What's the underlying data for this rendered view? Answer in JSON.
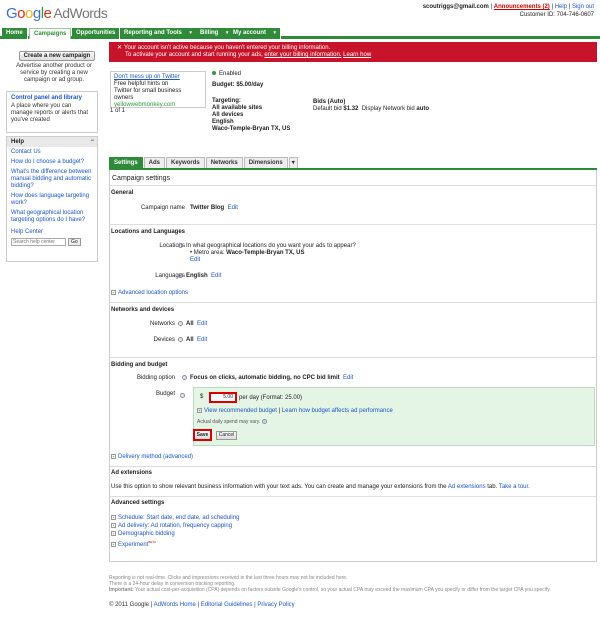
{
  "header": {
    "logo_google": [
      "G",
      "o",
      "o",
      "g",
      "l",
      "e"
    ],
    "logo_product": "AdWords",
    "email": "scoutriggs@gmail.com",
    "announcements": "Announcements (2)",
    "help": "Help",
    "signout": "Sign out",
    "customer_id": "Customer ID: 704-746-0607"
  },
  "nav": {
    "tabs": [
      "Home",
      "Campaigns",
      "Opportunities",
      "Reporting and Tools",
      "Billing",
      "My account"
    ]
  },
  "sidebar": {
    "new_campaign": "Create a new campaign",
    "new_campaign_text": "Advertise another product or service by creating a new campaign or ad group.",
    "control_panel_title": "Control panel and library",
    "control_panel_text": "A place where you can manage reports or alerts that you've created",
    "help_title": "Help",
    "help_minimize": "−",
    "help_links": [
      "Contact Us",
      "How do I choose a budget?",
      "What's the difference between manual bidding and automatic bidding?",
      "How does language targeting work?",
      "What geographical location targeting options do I have?"
    ],
    "help_center": "Help Center",
    "search_placeholder": "Search help center",
    "go": "Go"
  },
  "alert": {
    "close": "✕",
    "line1": "Your account isn't active because you haven't entered your billing information.",
    "line2": "To activate your account and start running your ads,",
    "link1": "enter your billing information.",
    "link2": "Learn how"
  },
  "ad": {
    "title": "Don't mess up on Twitter",
    "line1": "Free helpful hints on",
    "line2": "Twitter for small business owners",
    "url": "yellowwebmonkey.com",
    "pager": "1 of 1"
  },
  "summary": {
    "status": "Enabled",
    "budget": "Budget: $5.00/day",
    "targeting_label": "Targeting:",
    "targeting": [
      "All available sites",
      "All devices",
      "English",
      "Waco-Temple-Bryan TX, US"
    ],
    "bids_label": "Bids (Auto)",
    "bids_line_pre": "Default bid",
    "bids_value": "$1.32",
    "display_bid_pre": "Display Network bid",
    "display_bid_value": "auto"
  },
  "subtabs": [
    "Settings",
    "Ads",
    "Keywords",
    "Networks",
    "Dimensions"
  ],
  "settings": {
    "panel_title": "Campaign settings",
    "general": "General",
    "campaign_name_label": "Campaign name",
    "campaign_name": "Twitter Blog",
    "edit": "Edit",
    "locations_head": "Locations and Languages",
    "locations_label": "Locations",
    "locations_q": "In what geographical locations do you want your ads to appear?",
    "metro": "Metro area:",
    "metro_value": "Waco-Temple-Bryan TX, US",
    "languages_label": "Languages",
    "languages_value": "English",
    "advanced_location": "Advanced location options",
    "networks_head": "Networks and devices",
    "networks_label": "Networks",
    "devices_label": "Devices",
    "all": "All",
    "bidding_head": "Bidding and budget",
    "bidding_option_label": "Bidding option",
    "bidding_option": "Focus on clicks, automatic bidding, no CPC bid limit",
    "budget_label": "Budget",
    "currency": "$",
    "budget_value": "5.00",
    "budget_suffix": "per day (Format: 25.00)",
    "view_recommended": "View recommended budget",
    "learn_budget": "Learn how budget affects ad performance",
    "actual_spend": "Actual daily spend may vary.",
    "save": "Save",
    "cancel": "Cancel",
    "delivery": "Delivery method (advanced)",
    "ad_ext_head": "Ad extensions",
    "ad_ext_text": "Use this option to show relevant business information with your text ads. You can create and manage your extensions from the",
    "ad_ext_link": "Ad extensions",
    "ad_ext_tail": "tab.",
    "tour": "Take a tour.",
    "advanced_head": "Advanced settings",
    "advanced_items": [
      "Schedule: Start date, end date, ad scheduling",
      "Ad delivery: Ad rotation, frequency capping",
      "Demographic bidding",
      "Experiment"
    ],
    "beta": "BETA"
  },
  "footer": {
    "note1": "Reporting is not real-time. Clicks and impressions received in the last three hours may not be included here.",
    "note2": "There is a 24-hour delay in conversion tracking reporting.",
    "note3_b": "Important:",
    "note3": "Your actual cost-per-acquisition (CPA) depends on factors outside Google's control, so your actual CPA may exceed the maximum CPA you specify or differ from the target CPA you specify.",
    "copyright": "© 2011 Google",
    "links": [
      "AdWords Home",
      "Editorial Guidelines",
      "Privacy Policy"
    ]
  }
}
